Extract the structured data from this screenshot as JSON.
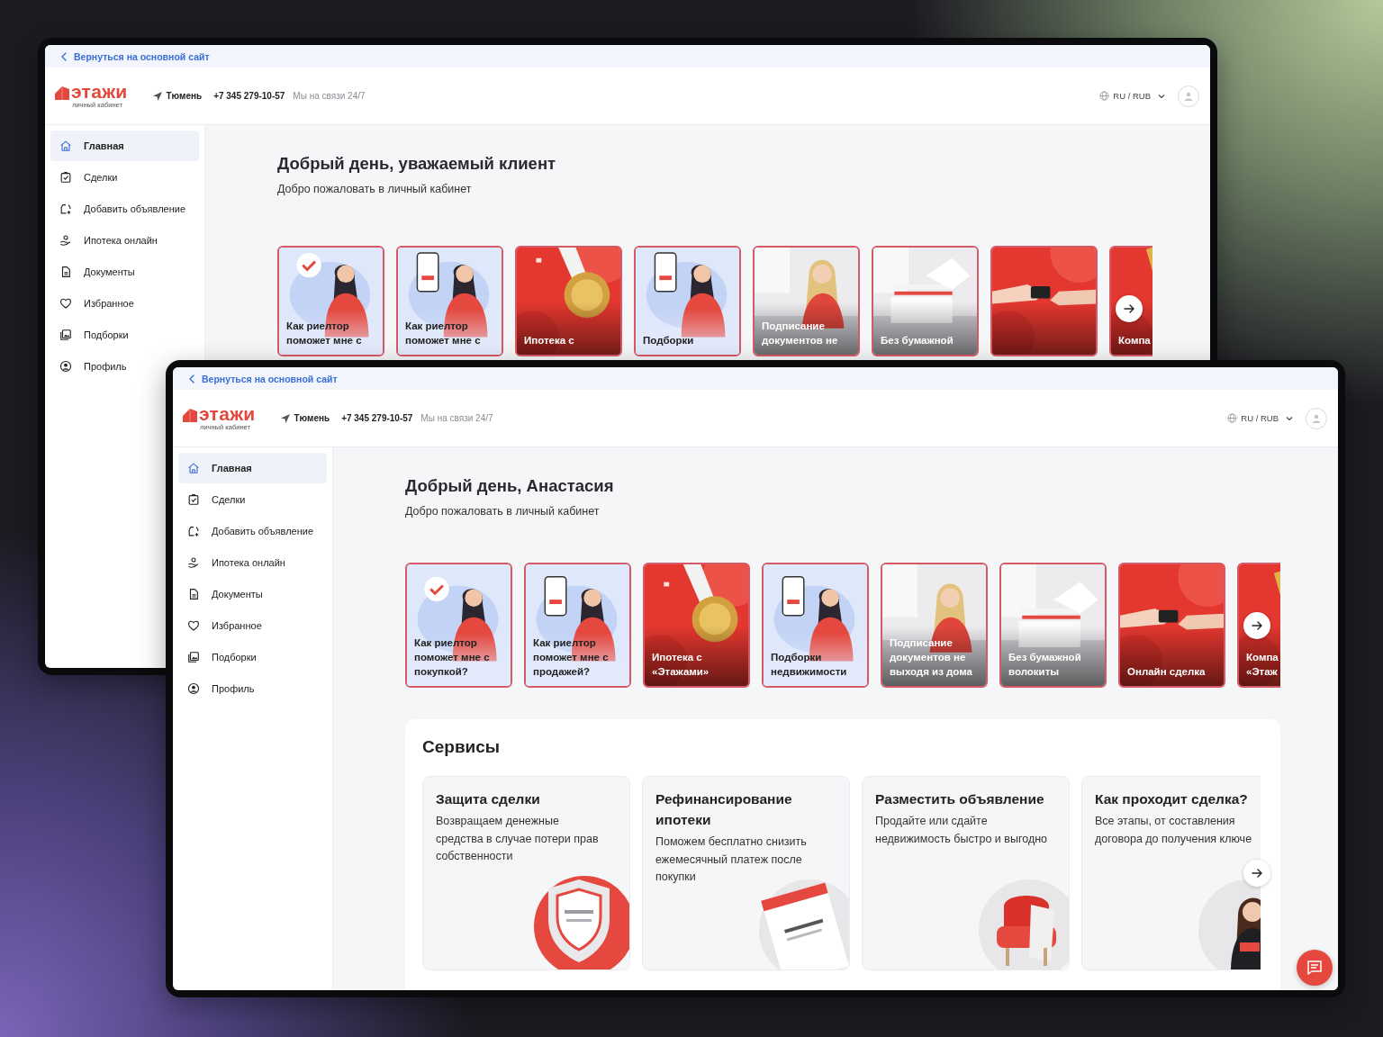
{
  "windows": [
    {
      "back_link": "Вернуться на основной сайт",
      "logo": {
        "name": "этажи",
        "caption": "личный кабинет"
      },
      "city": "Тюмень",
      "phone": "+7 345 279-10-57",
      "support": "Мы на связи 24/7",
      "locale": "RU / RUB",
      "nav": [
        {
          "label": "Главная",
          "selected": true
        },
        {
          "label": "Сделки",
          "selected": false
        },
        {
          "label": "Добавить объявление",
          "selected": false
        },
        {
          "label": "Ипотека онлайн",
          "selected": false
        },
        {
          "label": "Документы",
          "selected": false
        },
        {
          "label": "Избранное",
          "selected": false
        },
        {
          "label": "Подборки",
          "selected": false
        },
        {
          "label": "Профиль",
          "selected": false
        }
      ],
      "greeting": "Добрый день, уважаемый клиент",
      "welcome": "Добро пожаловать в личный кабинет",
      "stories": [
        {
          "kind": "picture",
          "title": "Как риелтор поможет мне с"
        },
        {
          "kind": "picture",
          "title": "Как риелтор поможет мне с"
        },
        {
          "kind": "picture",
          "title": "Ипотека с"
        },
        {
          "kind": "picture",
          "title": "Подборки"
        },
        {
          "kind": "picture",
          "title": "Подписание документов не"
        },
        {
          "kind": "picture",
          "title": "Без бумажной"
        },
        {
          "kind": "picture"
        },
        {
          "kind": "picture",
          "title": "Компа"
        }
      ]
    },
    {
      "back_link": "Вернуться на основной сайт",
      "logo": {
        "name": "этажи",
        "caption": "личный кабинет"
      },
      "city": "Тюмень",
      "phone": "+7 345 279-10-57",
      "support": "Мы на связи 24/7",
      "locale": "RU / RUB",
      "nav": [
        {
          "label": "Главная",
          "selected": true
        },
        {
          "label": "Сделки",
          "selected": false
        },
        {
          "label": "Добавить объявление",
          "selected": false
        },
        {
          "label": "Ипотека онлайн",
          "selected": false
        },
        {
          "label": "Документы",
          "selected": false
        },
        {
          "label": "Избранное",
          "selected": false
        },
        {
          "label": "Подборки",
          "selected": false
        },
        {
          "label": "Профиль",
          "selected": false
        }
      ],
      "greeting": "Добрый день, Анастасия",
      "welcome": "Добро пожаловать в личный кабинет",
      "stories": [
        {
          "kind": "picture",
          "title": "Как риелтор поможет мне с покупкой?"
        },
        {
          "kind": "picture",
          "title": "Как риелтор поможет мне с продажей?"
        },
        {
          "kind": "picture",
          "title": "Ипотека с «Этажами»"
        },
        {
          "kind": "picture",
          "title": "Подборки недвижимости"
        },
        {
          "kind": "picture",
          "title": "Подписание документов не выходя из дома"
        },
        {
          "kind": "picture",
          "title": "Без бумажной волокиты"
        },
        {
          "kind": "picture",
          "title": "Онлайн сделка"
        },
        {
          "kind": "picture",
          "title": "Компа\n«Этаж"
        }
      ],
      "services": {
        "title": "Сервисы",
        "items": [
          {
            "kind": "picture",
            "title": "Защита сделки",
            "text": "Возвращаем денежные средства в случае потери прав собственности"
          },
          {
            "kind": "picture",
            "title": "Рефинансирование ипотеки",
            "text": "Поможем бесплатно снизить ежемесячный платеж после покупки"
          },
          {
            "kind": "picture",
            "title": "Разместить объявление",
            "text": "Продайте или сдайте недвижимость быстро и выгодно"
          },
          {
            "kind": "picture",
            "title": "Как проходит сделка?",
            "text": "Все этапы, от составления договора до получения ключе"
          }
        ]
      }
    }
  ]
}
